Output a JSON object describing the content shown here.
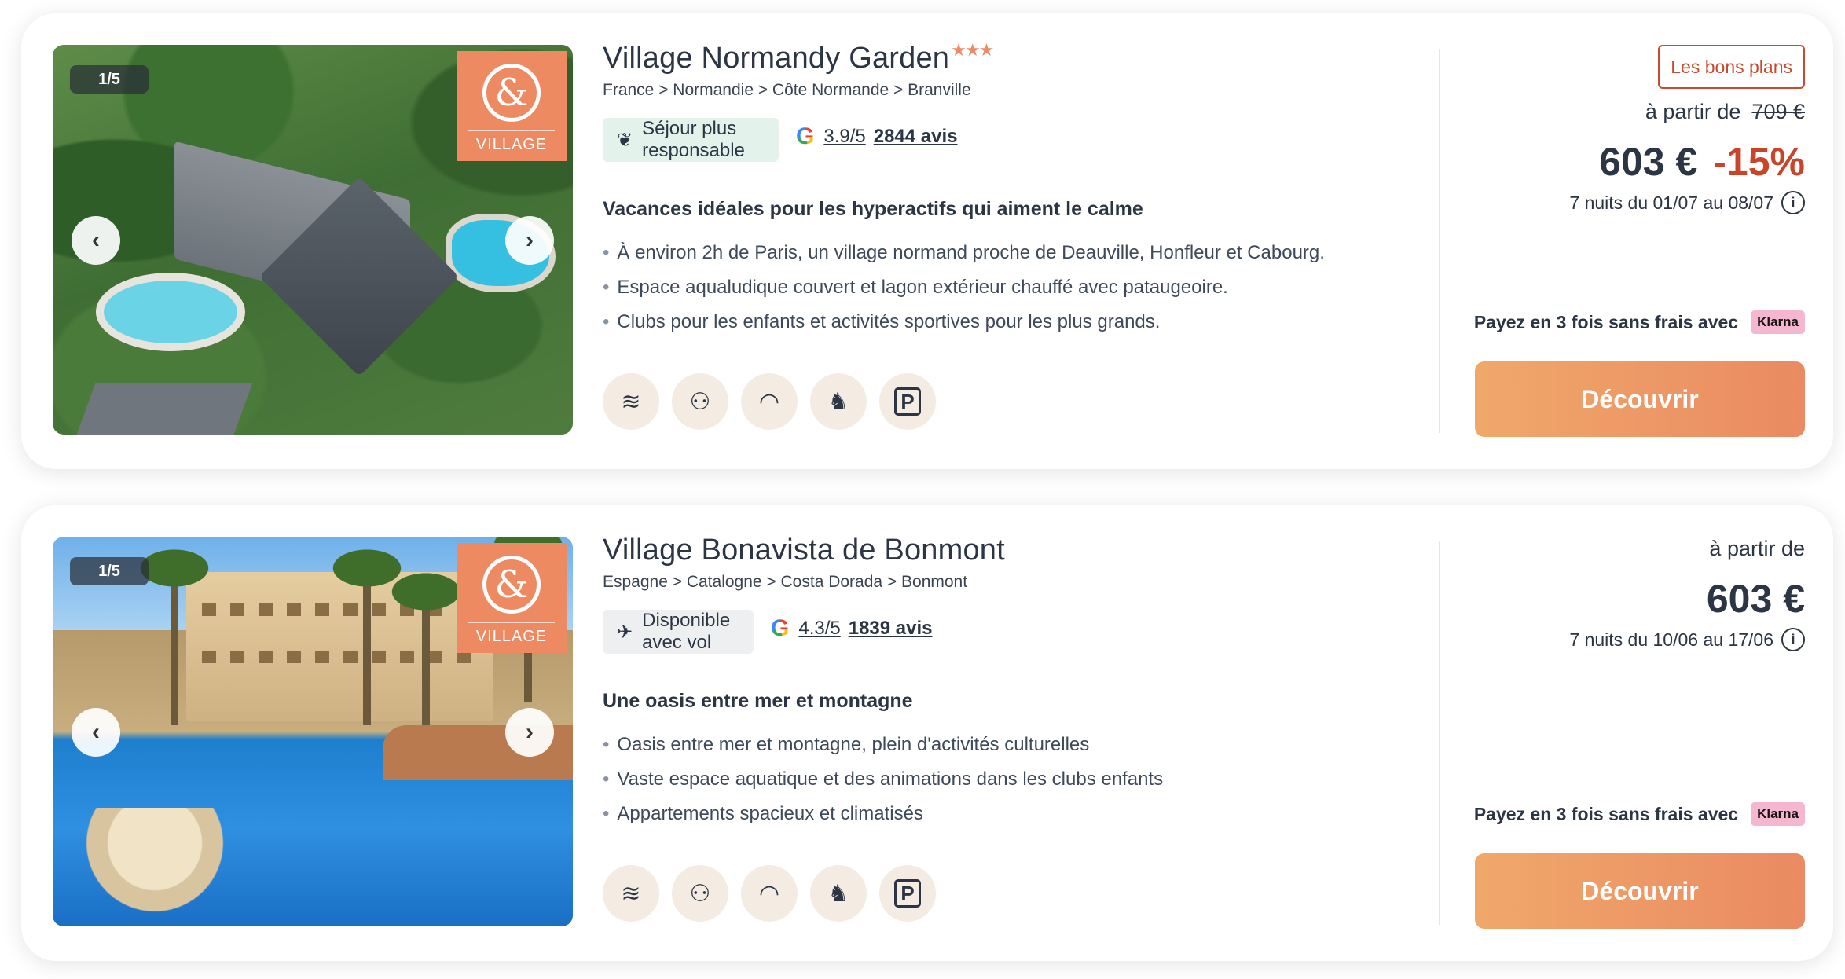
{
  "colors": {
    "accent": "#ea8a62",
    "discount": "#c8452a",
    "klarna": "#f5b6cf",
    "eco_tag": "#e3f3ec"
  },
  "cards": [
    {
      "gallery_counter": "1/5",
      "badge_text": "VILLAGE",
      "title": "Village Normandy Garden",
      "stars": "★★★",
      "breadcrumb": "France > Normandie > Côte Normande > Branville",
      "tag": {
        "icon": "leaf-icon",
        "glyph": "❦",
        "label": "Séjour plus responsable"
      },
      "rating": {
        "score": "3.9/5",
        "reviews": "2844 avis"
      },
      "subtitle": "Vacances idéales pour les hyperactifs qui aiment le calme",
      "bullets": [
        "À environ 2h de Paris, un village normand proche de Deauville, Honfleur et Cabourg.",
        "Espace aqualudique couvert et lagon extérieur chauffé avec pataugeoire.",
        "Clubs pour les enfants et activités sportives pour les plus grands."
      ],
      "amenities": [
        {
          "icon": "pool-waves-icon",
          "glyph": "≋"
        },
        {
          "icon": "kids-club-icon",
          "glyph": "⚇"
        },
        {
          "icon": "wifi-icon",
          "glyph": "◠"
        },
        {
          "icon": "horse-riding-icon",
          "glyph": "♞"
        },
        {
          "icon": "parking-icon",
          "glyph": "P"
        }
      ],
      "promo_label": "Les bons plans",
      "from_label": "à partir de",
      "old_price": "709 €",
      "price": "603 €",
      "discount": "-15%",
      "dates": "7 nuits du 01/07 au 08/07",
      "klarna_text": "Payez en 3 fois sans frais avec",
      "klarna_logo": "Klarna",
      "cta": "Découvrir"
    },
    {
      "gallery_counter": "1/5",
      "badge_text": "VILLAGE",
      "title": "Village Bonavista de Bonmont",
      "breadcrumb": "Espagne > Catalogne > Costa Dorada > Bonmont",
      "tag": {
        "icon": "plane-icon",
        "glyph": "✈",
        "label": "Disponible avec vol"
      },
      "rating": {
        "score": "4.3/5",
        "reviews": "1839 avis"
      },
      "subtitle": "Une oasis entre mer et montagne",
      "bullets": [
        "Oasis entre mer et montagne, plein d'activités culturelles",
        "Vaste espace aquatique et des animations dans les clubs enfants",
        "Appartements spacieux et climatisés"
      ],
      "amenities": [
        {
          "icon": "pool-waves-icon",
          "glyph": "≋"
        },
        {
          "icon": "kids-club-icon",
          "glyph": "⚇"
        },
        {
          "icon": "wifi-icon",
          "glyph": "◠"
        },
        {
          "icon": "horse-riding-icon",
          "glyph": "♞"
        },
        {
          "icon": "parking-icon",
          "glyph": "P"
        }
      ],
      "from_label": "à partir de",
      "price": "603 €",
      "dates": "7 nuits du 10/06 au 17/06",
      "klarna_text": "Payez en 3 fois sans frais avec",
      "klarna_logo": "Klarna",
      "cta": "Découvrir"
    }
  ]
}
